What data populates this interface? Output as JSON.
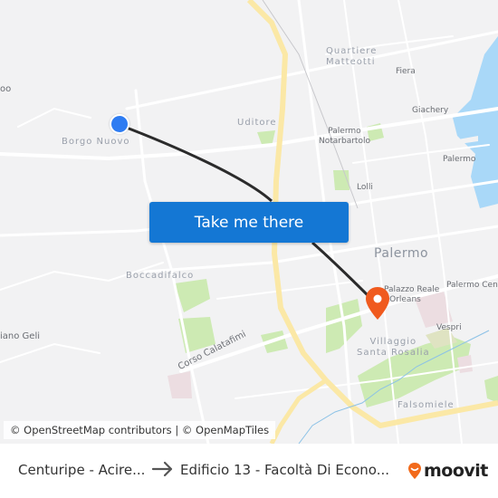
{
  "map": {
    "labels": {
      "quartiere_matteotti": "Quartiere\nMatteotti",
      "fiera": "Fiera",
      "giachery": "Giachery",
      "palermo_port": "Palermo",
      "palermo_notarbartolo": "Palermo\nNotarbartolo",
      "uditore": "Uditore",
      "lolli": "Lolli",
      "borgo_nuovo": "Borgo Nuovo",
      "boccadifalco": "Boccadifalco",
      "palermo_city": "Palermo",
      "palazzo_reale": "Palazzo Reale\n- Orleans",
      "palermo_centrale": "Palermo Centr",
      "vespri": "Vespri",
      "villaggio_santa_rosalia": "Villaggio\nSanta Rosalia",
      "falsomiele": "Falsomiele",
      "corso_calatafimi": "Corso Calatafimi",
      "piano_geli": "iano Geli",
      "left_edge": "oo"
    },
    "colors": {
      "land": "#f2f2f3",
      "road": "#ffffff",
      "highway": "#fbe8a6",
      "park": "#cdeab3",
      "water": "#a9d8f8",
      "route": "#2b2b2b",
      "origin": "#2e7cf2",
      "destination": "#f05a1e"
    }
  },
  "cta": {
    "label": "Take me there",
    "color": "#1477d4"
  },
  "attribution": "© OpenStreetMap contributors | © OpenMapTiles",
  "footer": {
    "from": "Centuripe - Acire...",
    "to": "Edificio 13 - Facoltà Di Econo...",
    "brand": "moovit",
    "brand_color": "#f26a1b"
  }
}
